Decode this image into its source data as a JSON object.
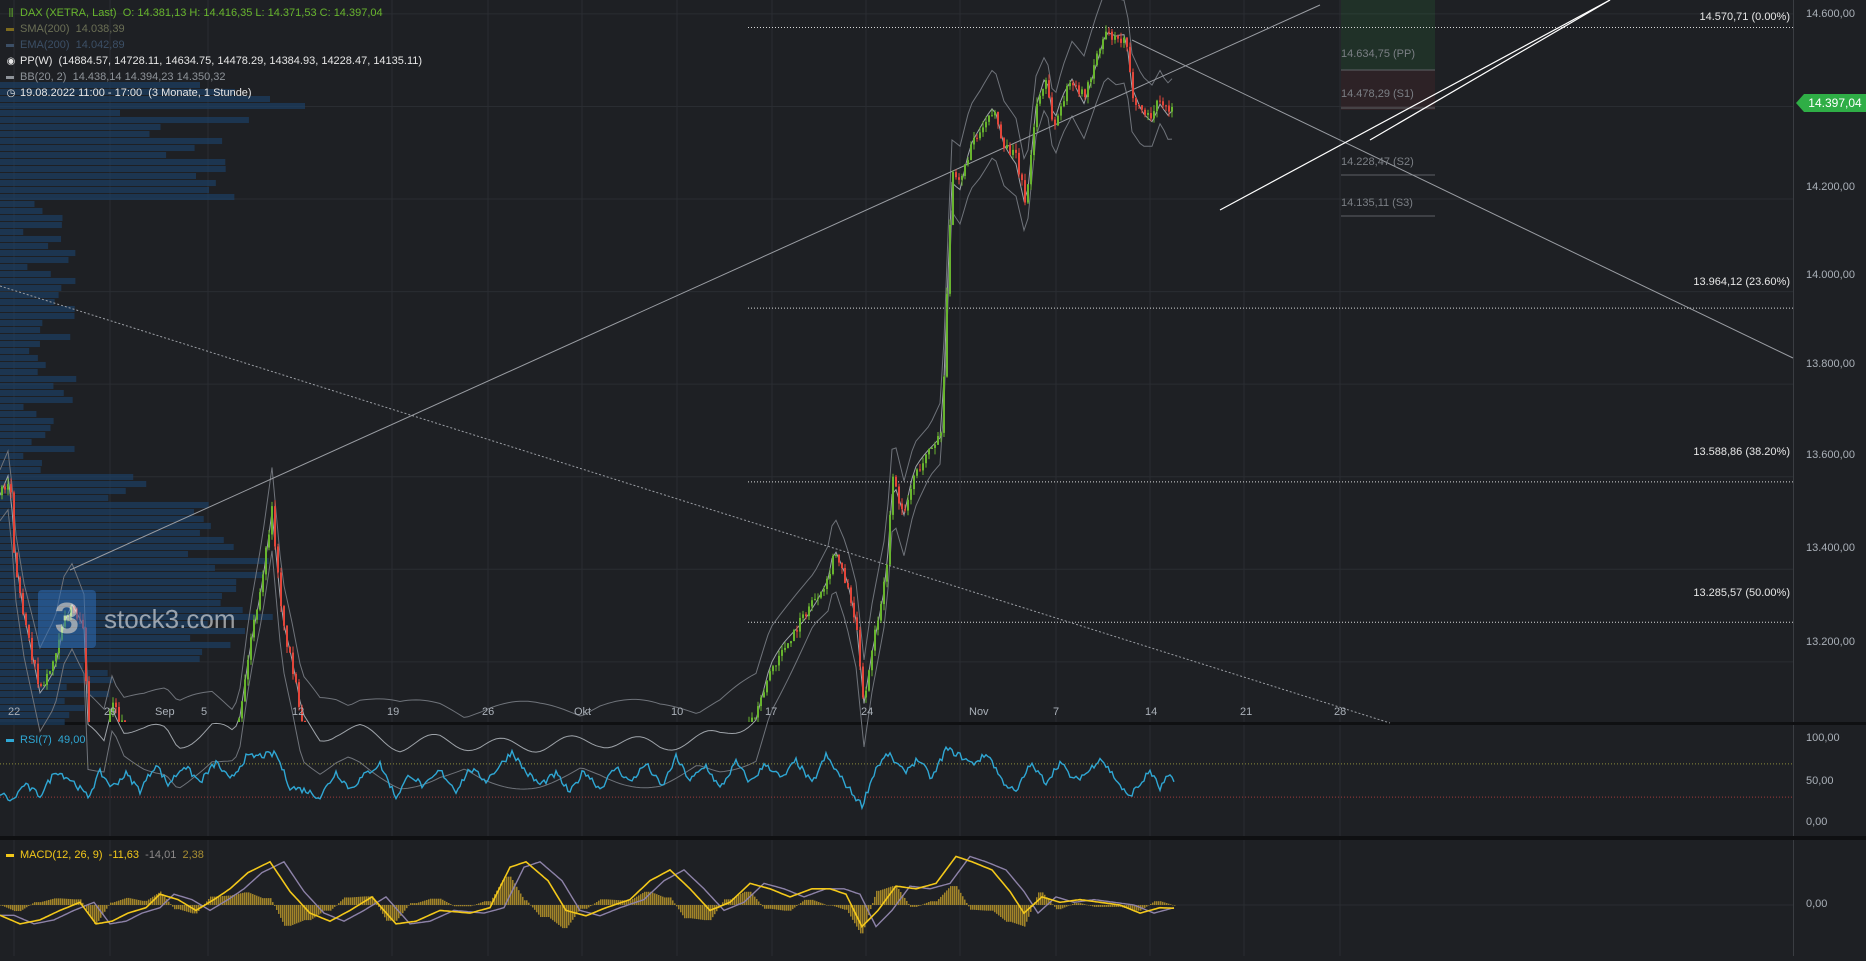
{
  "header": {
    "symbol_line": "DAX (XETRA, Last)",
    "ohlc": "O: 14.381,13  H: 14.416,35  L: 14.371,53  C: 14.397,04",
    "sma_label": "SMA(200)",
    "sma_value": "14.038,39",
    "ema_label": "EMA(200)",
    "ema_value": "14.042,89",
    "pp_label": "PP(W)",
    "pp_values": "(14884.57, 14728.11, 14634.75, 14478.29, 14384.93, 14228.47, 14135.11)",
    "bb_label": "BB(20, 2)",
    "bb_values": "14.438,14  14.394,23  14.350,32",
    "range_label": "19.08.2022 11:00 - 17:00",
    "range_detail": "(3 Monate, 1 Stunde)"
  },
  "colors": {
    "background": "#1e2024",
    "up": "#68b52e",
    "down": "#e3463a",
    "rsi": "#2fa7d4",
    "macd": "#f3c81a",
    "signal": "#8d82a8",
    "price_tag": "#2fae46",
    "volume_profile": "#1c3f63"
  },
  "brand": {
    "logo_glyph": "3",
    "logo_text": "stock3.com"
  },
  "price_tag": "14.397,04",
  "pivots": {
    "pp": "14.634,75 (PP)",
    "s1": "14.478,29 (S1)",
    "s2": "14.228,47 (S2)",
    "s3": "14.135,11 (S3)"
  },
  "rsi_panel": {
    "label": "RSI(7)",
    "value": "49,00",
    "ticks": [
      "100,00",
      "50,00",
      "0,00"
    ]
  },
  "macd_panel": {
    "label": "MACD(12, 26, 9)",
    "value": "-11,63",
    "signal_value": "-14,01",
    "hist_value": "2,38",
    "ticks": [
      "0,00"
    ]
  },
  "chart_data": {
    "type": "candlestick",
    "title": "DAX (XETRA, Last)",
    "interval": "1 Stunde",
    "y_ticks": [
      "14.600,00",
      "14.400,00",
      "14.200,00",
      "14.000,00",
      "13.800,00",
      "13.600,00",
      "13.400,00",
      "13.200,00"
    ],
    "ylim": [
      13070,
      14630
    ],
    "x_ticks": [
      "22",
      "29",
      "Sep",
      "5",
      "12",
      "19",
      "26",
      "Okt",
      "10",
      "17",
      "24",
      "Nov",
      "7",
      "14",
      "21",
      "28"
    ],
    "fibonacci": [
      {
        "label": "14.570,71 (0.00%)",
        "value": 14570.71
      },
      {
        "label": "13.964,12 (23.60%)",
        "value": 13964.12
      },
      {
        "label": "13.588,86 (38.20%)",
        "value": 13588.86
      },
      {
        "label": "13.285,57 (50.00%)",
        "value": 13285.57
      }
    ],
    "last_close": 14397.04,
    "series": [
      {
        "name": "DAX",
        "anchors": [
          [
            0,
            13560
          ],
          [
            10,
            13600
          ],
          [
            14,
            13430
          ],
          [
            24,
            13290
          ],
          [
            40,
            13140
          ],
          [
            55,
            13200
          ],
          [
            64,
            13290
          ],
          [
            72,
            13320
          ],
          [
            84,
            13260
          ],
          [
            88,
            13050
          ],
          [
            104,
            13030
          ],
          [
            112,
            13110
          ],
          [
            124,
            13060
          ],
          [
            144,
            13050
          ],
          [
            166,
            13050
          ],
          [
            178,
            13020
          ],
          [
            194,
            13040
          ],
          [
            212,
            13060
          ],
          [
            234,
            13040
          ],
          [
            240,
            13080
          ],
          [
            250,
            13240
          ],
          [
            262,
            13380
          ],
          [
            272,
            13530
          ],
          [
            282,
            13290
          ],
          [
            292,
            13190
          ],
          [
            302,
            13080
          ],
          [
            320,
            13040
          ],
          [
            336,
            13050
          ],
          [
            360,
            13050
          ],
          [
            400,
            13020
          ],
          [
            440,
            13030
          ],
          [
            480,
            13020
          ],
          [
            540,
            13020
          ],
          [
            600,
            13030
          ],
          [
            660,
            13020
          ],
          [
            720,
            13040
          ],
          [
            756,
            13080
          ],
          [
            770,
            13180
          ],
          [
            790,
            13250
          ],
          [
            812,
            13330
          ],
          [
            828,
            13380
          ],
          [
            834,
            13440
          ],
          [
            846,
            13370
          ],
          [
            856,
            13280
          ],
          [
            864,
            13110
          ],
          [
            872,
            13230
          ],
          [
            886,
            13390
          ],
          [
            893,
            13600
          ],
          [
            904,
            13510
          ],
          [
            914,
            13600
          ],
          [
            928,
            13650
          ],
          [
            942,
            13700
          ],
          [
            946,
            13950
          ],
          [
            952,
            14250
          ],
          [
            960,
            14230
          ],
          [
            970,
            14310
          ],
          [
            980,
            14340
          ],
          [
            994,
            14390
          ],
          [
            1004,
            14320
          ],
          [
            1016,
            14290
          ],
          [
            1026,
            14190
          ],
          [
            1036,
            14400
          ],
          [
            1046,
            14460
          ],
          [
            1054,
            14350
          ],
          [
            1062,
            14410
          ],
          [
            1072,
            14460
          ],
          [
            1084,
            14420
          ],
          [
            1096,
            14500
          ],
          [
            1106,
            14560
          ],
          [
            1116,
            14540
          ],
          [
            1126,
            14540
          ],
          [
            1132,
            14430
          ],
          [
            1142,
            14390
          ],
          [
            1152,
            14380
          ],
          [
            1160,
            14420
          ],
          [
            1168,
            14390
          ],
          [
            1174,
            14397
          ]
        ]
      },
      {
        "name": "RSI(7)",
        "anchors": [
          [
            0,
            35
          ],
          [
            12,
            25
          ],
          [
            24,
            45
          ],
          [
            40,
            32
          ],
          [
            56,
            62
          ],
          [
            72,
            50
          ],
          [
            88,
            30
          ],
          [
            100,
            60
          ],
          [
            112,
            42
          ],
          [
            126,
            58
          ],
          [
            140,
            38
          ],
          [
            156,
            70
          ],
          [
            168,
            45
          ],
          [
            184,
            68
          ],
          [
            200,
            48
          ],
          [
            216,
            72
          ],
          [
            230,
            50
          ],
          [
            246,
            78
          ],
          [
            262,
            80
          ],
          [
            276,
            82
          ],
          [
            290,
            42
          ],
          [
            306,
            38
          ],
          [
            320,
            30
          ],
          [
            336,
            60
          ],
          [
            350,
            40
          ],
          [
            366,
            58
          ],
          [
            380,
            70
          ],
          [
            396,
            30
          ],
          [
            410,
            58
          ],
          [
            424,
            42
          ],
          [
            440,
            62
          ],
          [
            456,
            38
          ],
          [
            470,
            64
          ],
          [
            486,
            50
          ],
          [
            500,
            68
          ],
          [
            512,
            85
          ],
          [
            526,
            60
          ],
          [
            540,
            45
          ],
          [
            556,
            58
          ],
          [
            570,
            35
          ],
          [
            584,
            62
          ],
          [
            600,
            40
          ],
          [
            616,
            66
          ],
          [
            630,
            48
          ],
          [
            646,
            70
          ],
          [
            662,
            42
          ],
          [
            676,
            78
          ],
          [
            690,
            50
          ],
          [
            706,
            68
          ],
          [
            720,
            40
          ],
          [
            736,
            72
          ],
          [
            750,
            48
          ],
          [
            766,
            70
          ],
          [
            782,
            52
          ],
          [
            796,
            74
          ],
          [
            812,
            46
          ],
          [
            826,
            80
          ],
          [
            840,
            55
          ],
          [
            852,
            35
          ],
          [
            862,
            20
          ],
          [
            876,
            65
          ],
          [
            888,
            82
          ],
          [
            904,
            60
          ],
          [
            918,
            76
          ],
          [
            932,
            52
          ],
          [
            946,
            88
          ],
          [
            960,
            80
          ],
          [
            972,
            70
          ],
          [
            988,
            82
          ],
          [
            1002,
            50
          ],
          [
            1016,
            35
          ],
          [
            1030,
            70
          ],
          [
            1046,
            48
          ],
          [
            1060,
            72
          ],
          [
            1074,
            50
          ],
          [
            1088,
            60
          ],
          [
            1100,
            78
          ],
          [
            1114,
            55
          ],
          [
            1128,
            30
          ],
          [
            1140,
            45
          ],
          [
            1150,
            62
          ],
          [
            1160,
            40
          ],
          [
            1168,
            55
          ],
          [
            1174,
            49
          ]
        ]
      },
      {
        "name": "MACD(12, 26, 9)",
        "anchors": [
          [
            0,
            -38
          ],
          [
            20,
            -70
          ],
          [
            40,
            -55
          ],
          [
            60,
            -20
          ],
          [
            80,
            10
          ],
          [
            96,
            -70
          ],
          [
            112,
            -60
          ],
          [
            128,
            -30
          ],
          [
            146,
            -10
          ],
          [
            160,
            40
          ],
          [
            178,
            20
          ],
          [
            196,
            -20
          ],
          [
            214,
            20
          ],
          [
            230,
            60
          ],
          [
            248,
            120
          ],
          [
            270,
            160
          ],
          [
            290,
            50
          ],
          [
            310,
            -30
          ],
          [
            330,
            -60
          ],
          [
            350,
            -20
          ],
          [
            372,
            30
          ],
          [
            396,
            -70
          ],
          [
            416,
            -60
          ],
          [
            440,
            -20
          ],
          [
            470,
            -30
          ],
          [
            490,
            -10
          ],
          [
            510,
            140
          ],
          [
            526,
            160
          ],
          [
            548,
            90
          ],
          [
            566,
            -20
          ],
          [
            586,
            -40
          ],
          [
            606,
            -10
          ],
          [
            630,
            20
          ],
          [
            650,
            90
          ],
          [
            670,
            130
          ],
          [
            690,
            60
          ],
          [
            710,
            -20
          ],
          [
            730,
            10
          ],
          [
            750,
            80
          ],
          [
            770,
            60
          ],
          [
            790,
            30
          ],
          [
            812,
            60
          ],
          [
            830,
            60
          ],
          [
            846,
            40
          ],
          [
            862,
            -80
          ],
          [
            878,
            -20
          ],
          [
            896,
            70
          ],
          [
            916,
            60
          ],
          [
            936,
            80
          ],
          [
            956,
            180
          ],
          [
            972,
            160
          ],
          [
            992,
            130
          ],
          [
            1010,
            50
          ],
          [
            1024,
            -30
          ],
          [
            1042,
            30
          ],
          [
            1060,
            10
          ],
          [
            1080,
            20
          ],
          [
            1100,
            10
          ],
          [
            1120,
            0
          ],
          [
            1140,
            -30
          ],
          [
            1160,
            -10
          ],
          [
            1174,
            -12
          ]
        ]
      }
    ]
  }
}
